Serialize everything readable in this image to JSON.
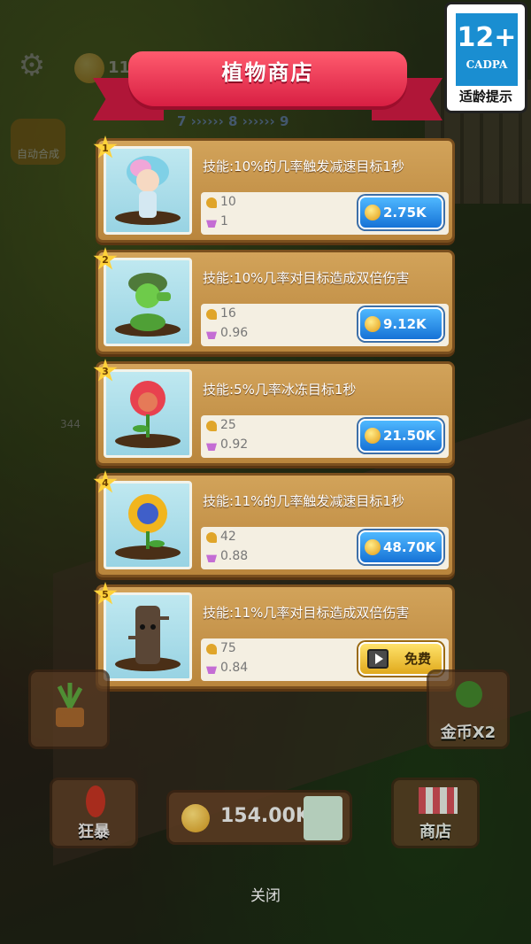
{
  "age_rating": {
    "number": "12+",
    "org": "CADPA",
    "tip": "适龄提示"
  },
  "shop": {
    "title": "植物商店",
    "items": [
      {
        "rank": "1",
        "skill": "技能:10%的几率触发减速目标1秒",
        "attack": "10",
        "speed": "1",
        "price": "2.75K",
        "price_type": "coin",
        "plant_icon": "ice-girl-plant-icon"
      },
      {
        "rank": "2",
        "skill": "技能:10%几率对目标造成双倍伤害",
        "attack": "16",
        "speed": "0.96",
        "price": "9.12K",
        "price_type": "coin",
        "plant_icon": "pea-shooter-plant-icon"
      },
      {
        "rank": "3",
        "skill": "技能:5%几率冰冻目标1秒",
        "attack": "25",
        "speed": "0.92",
        "price": "21.50K",
        "price_type": "coin",
        "plant_icon": "flower-plant-icon"
      },
      {
        "rank": "4",
        "skill": "技能:11%的几率触发减速目标1秒",
        "attack": "42",
        "speed": "0.88",
        "price": "48.70K",
        "price_type": "coin",
        "plant_icon": "sunflower-plant-icon"
      },
      {
        "rank": "5",
        "skill": "技能:11%几率对目标造成双倍伤害",
        "attack": "75",
        "speed": "0.84",
        "price": "免费",
        "price_type": "free-video",
        "plant_icon": "tree-stump-plant-icon"
      }
    ]
  },
  "background": {
    "top_coin": "11",
    "auto_label": "自动合成",
    "stage_numbers": [
      "7",
      "8",
      "9"
    ],
    "gold_x2": "金币X2",
    "rage": "狂暴",
    "coins_total": "154.00K",
    "store": "商店",
    "enemy_hp": "344"
  },
  "close_label": "关闭"
}
